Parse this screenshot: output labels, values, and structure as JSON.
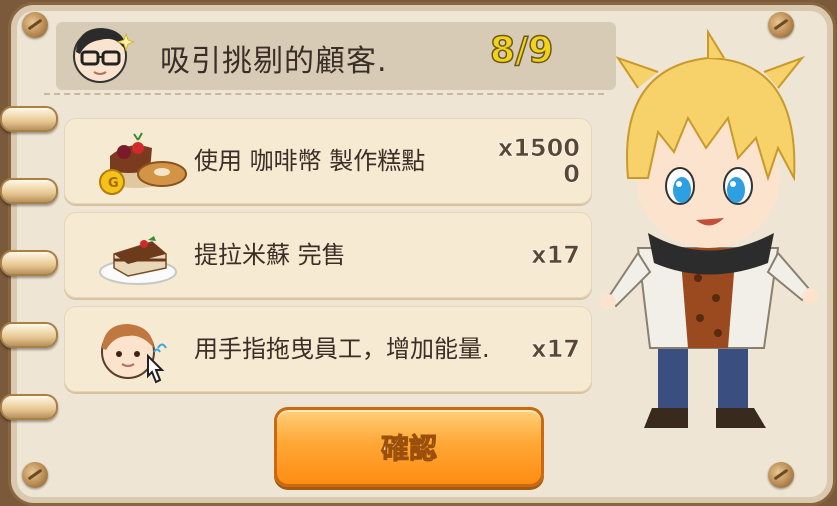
{
  "quest": {
    "title": "吸引挑剔的顧客.",
    "progress": "8/9",
    "giver_icon": "glasses-boy-avatar-icon"
  },
  "tasks": [
    {
      "icon": "cake-and-coin-icon",
      "text": "使用 咖啡幣 製作糕點",
      "count": "x15000"
    },
    {
      "icon": "tiramisu-icon",
      "text": "提拉米蘇 完售",
      "count": "x17"
    },
    {
      "icon": "staff-drag-hand-icon",
      "text": "用手指拖曳員工，增加能量.",
      "count": "x17"
    }
  ],
  "buttons": {
    "confirm": "確認"
  },
  "colors": {
    "board": "#efe5d4",
    "progress": "#f4d21c",
    "confirm_button": "#ffa735",
    "task_card": "#f6ead3"
  }
}
